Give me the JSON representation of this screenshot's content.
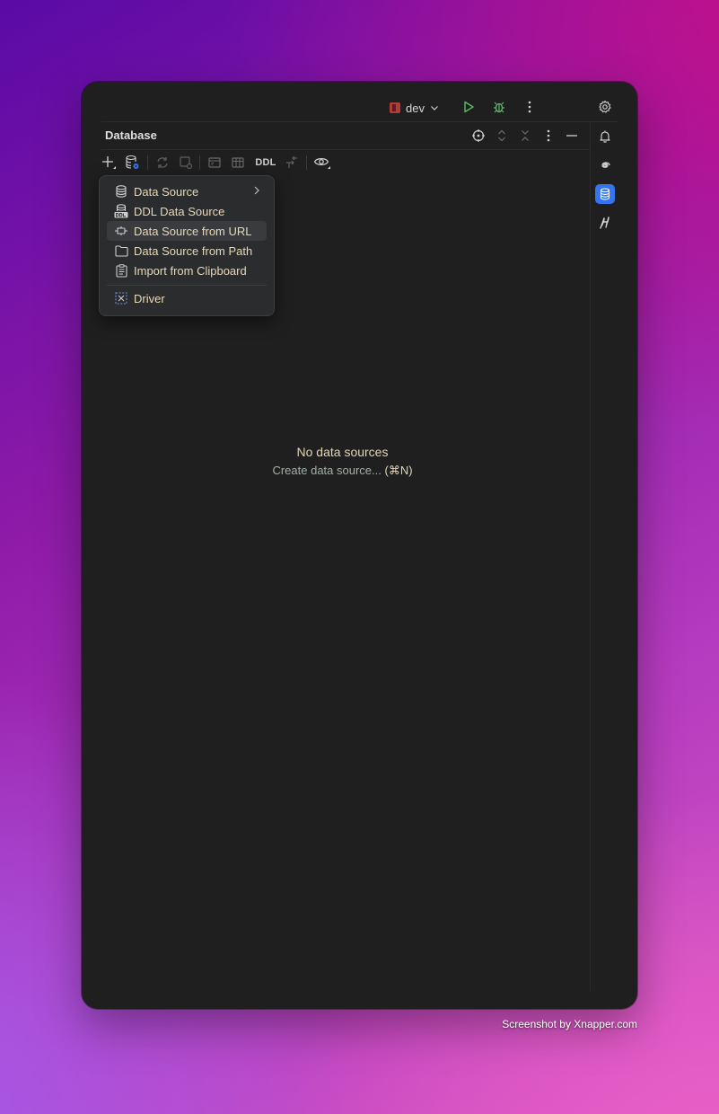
{
  "topbar": {
    "config_name": "dev"
  },
  "panel": {
    "title": "Database"
  },
  "toolbar": {
    "ddl_label": "DDL"
  },
  "menu": {
    "items": [
      {
        "label": "Data Source",
        "icon": "database-icon",
        "has_submenu": true
      },
      {
        "label": "DDL Data Source",
        "icon": "ddl-database-icon"
      },
      {
        "label": "Data Source from URL",
        "icon": "plug-icon"
      },
      {
        "label": "Data Source from Path",
        "icon": "folder-icon"
      },
      {
        "label": "Import from Clipboard",
        "icon": "clipboard-icon"
      },
      {
        "label": "Driver",
        "icon": "driver-icon"
      }
    ]
  },
  "empty_state": {
    "title": "No data sources",
    "link": "Create data source...",
    "shortcut": "(⌘N)"
  },
  "watermark": "Screenshot by Xnapper.com",
  "colors": {
    "window_bg": "#1f1f1f",
    "accent": "#3574f0",
    "run_green": "#5fb865",
    "menu_text": "#e8d9b5"
  }
}
